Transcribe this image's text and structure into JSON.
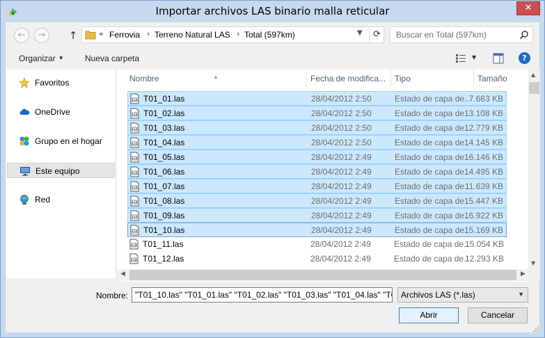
{
  "window": {
    "title": "Importar archivos LAS binario malla reticular",
    "close_label": "✕"
  },
  "address": {
    "overflow": "«",
    "crumbs": [
      "Ferrovia",
      "Terreno Natural LAS",
      "Total (597km)"
    ]
  },
  "search": {
    "placeholder": "Buscar en Total (597km)"
  },
  "toolbar": {
    "organize": "Organizar",
    "new_folder": "Nueva carpeta",
    "help": "?"
  },
  "navpane": {
    "items": [
      {
        "label": "Favoritos",
        "icon": "star-icon"
      },
      {
        "label": "OneDrive",
        "icon": "cloud-icon"
      },
      {
        "label": "Grupo en el hogar",
        "icon": "homegroup-icon"
      },
      {
        "label": "Este equipo",
        "icon": "computer-icon",
        "selected": true
      },
      {
        "label": "Red",
        "icon": "network-icon"
      }
    ]
  },
  "columns": {
    "name": "Nombre",
    "date": "Fecha de modifica...",
    "type": "Tipo",
    "size": "Tamaño"
  },
  "files": [
    {
      "name": "T01_01.las",
      "date": "28/04/2012 2:50",
      "type": "Estado de capa de...",
      "size": "7.663 KB",
      "selected": true
    },
    {
      "name": "T01_02.las",
      "date": "28/04/2012 2:50",
      "type": "Estado de capa de...",
      "size": "13.108 KB",
      "selected": true
    },
    {
      "name": "T01_03.las",
      "date": "28/04/2012 2:50",
      "type": "Estado de capa de...",
      "size": "12.779 KB",
      "selected": true
    },
    {
      "name": "T01_04.las",
      "date": "28/04/2012 2:50",
      "type": "Estado de capa de...",
      "size": "14.145 KB",
      "selected": true
    },
    {
      "name": "T01_05.las",
      "date": "28/04/2012 2:49",
      "type": "Estado de capa de...",
      "size": "16.146 KB",
      "selected": true
    },
    {
      "name": "T01_06.las",
      "date": "28/04/2012 2:49",
      "type": "Estado de capa de...",
      "size": "14.495 KB",
      "selected": true
    },
    {
      "name": "T01_07.las",
      "date": "28/04/2012 2:49",
      "type": "Estado de capa de...",
      "size": "11.639 KB",
      "selected": true
    },
    {
      "name": "T01_08.las",
      "date": "28/04/2012 2:49",
      "type": "Estado de capa de...",
      "size": "15.447 KB",
      "selected": true
    },
    {
      "name": "T01_09.las",
      "date": "28/04/2012 2:49",
      "type": "Estado de capa de...",
      "size": "16.922 KB",
      "selected": true
    },
    {
      "name": "T01_10.las",
      "date": "28/04/2012 2:49",
      "type": "Estado de capa de...",
      "size": "15.169 KB",
      "selected": true,
      "focused": true
    },
    {
      "name": "T01_11.las",
      "date": "28/04/2012 2:49",
      "type": "Estado de capa de...",
      "size": "15.054 KB",
      "selected": false
    },
    {
      "name": "T01_12.las",
      "date": "28/04/2012 2:49",
      "type": "Estado de capa de...",
      "size": "12.293 KB",
      "selected": false
    }
  ],
  "filename": {
    "label": "Nombre:",
    "value": "\"T01_10.las\" \"T01_01.las\" \"T01_02.las\" \"T01_03.las\" \"T01_04.las\" \"T0"
  },
  "filter": {
    "selected": "Archivos LAS (*.las)"
  },
  "buttons": {
    "open": "Abrir",
    "cancel": "Cancelar"
  },
  "colors": {
    "selection": "#cce8ff",
    "selection_border": "#99d1ff",
    "accent": "#1e6bc4"
  }
}
